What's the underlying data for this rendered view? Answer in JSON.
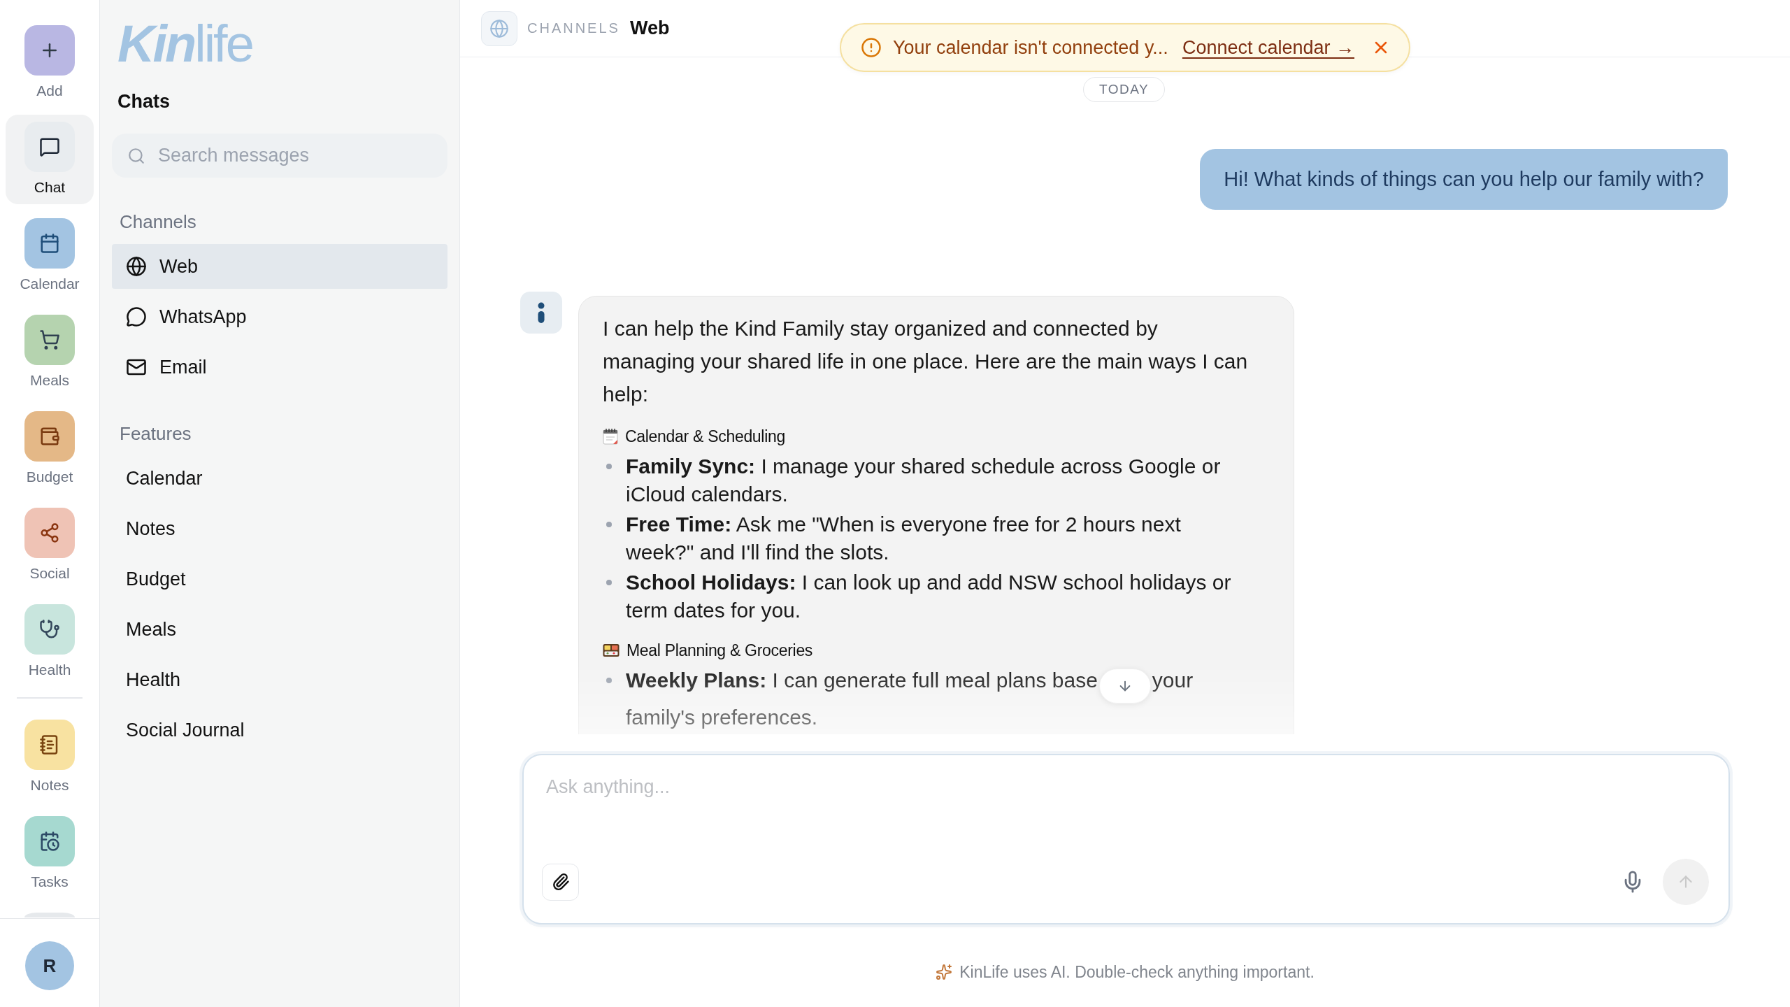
{
  "rail": {
    "sections": [
      {
        "items": [
          {
            "kind": "tile",
            "label": "Add",
            "selected": false,
            "color": "#b9b7e3"
          },
          {
            "kind": "tile",
            "label": "Chat",
            "selected": true,
            "color": "#e8ecef"
          },
          {
            "kind": "tile",
            "label": "Calendar",
            "selected": false,
            "color": "#a3c4e2"
          },
          {
            "kind": "tile",
            "label": "Meals",
            "selected": false,
            "color": "#b5d3af"
          },
          {
            "kind": "tile",
            "label": "Budget",
            "selected": false,
            "color": "#e4b887"
          },
          {
            "kind": "tile",
            "label": "Social",
            "selected": false,
            "color": "#efc3b5"
          },
          {
            "kind": "tile",
            "label": "Health",
            "selected": false,
            "color": "#c8e5dd"
          }
        ]
      },
      {
        "items": [
          {
            "kind": "tile",
            "label": "Notes",
            "selected": false,
            "color": "#f8e2a1"
          },
          {
            "kind": "tile",
            "label": "Tasks",
            "selected": false,
            "color": "#a6d9d0"
          },
          {
            "kind": "clipped",
            "selected": false,
            "color": "#e6e9ec"
          }
        ]
      }
    ],
    "avatar": "R"
  },
  "sidebar": {
    "logo": "**Kin**life",
    "title": "Chats",
    "search": {
      "placeholder": "Search messages"
    },
    "groups": [
      {
        "kind": "iconic",
        "heading": "Channels",
        "items": [
          {
            "label": "Web",
            "selected": true
          },
          {
            "label": "WhatsApp",
            "selected": false
          },
          {
            "label": "Email",
            "selected": false
          }
        ]
      },
      {
        "kind": "plain",
        "heading": "Features",
        "items": [
          {
            "label": "Calendar",
            "selected": false
          },
          {
            "label": "Notes",
            "selected": false
          },
          {
            "label": "Budget",
            "selected": false
          },
          {
            "label": "Meals",
            "selected": false
          },
          {
            "label": "Health",
            "selected": false
          },
          {
            "label": "Social Journal",
            "selected": false
          }
        ]
      }
    ]
  },
  "header": {
    "section": "CHANNELS",
    "title": "Web"
  },
  "banner": {
    "message": "Your calendar isn't connected y...",
    "link": "Connect calendar →"
  },
  "chat": {
    "date": "TODAY",
    "messages": [
      {
        "kind": "user",
        "text": "Hi! What kinds of things can you help our family with?"
      },
      {
        "kind": "assistant",
        "intro": "I can help the Kind Family stay organized and connected by managing your shared life in one place. Here are the main ways I can help:",
        "sections": [
          {
            "heading": "Calendar & Scheduling",
            "bullets": [
              {
                "text": "**Family Sync:** I manage your shared schedule across Google or iCloud calendars."
              },
              {
                "text": "**Free Time:** Ask me \"When is everyone free for 2 hours next week?\" and I'll find the slots."
              },
              {
                "text": "**School Holidays:** I can look up and add NSW school holidays or term dates for you."
              }
            ]
          },
          {
            "heading": "Meal Planning & Groceries",
            "bullets": [
              {
                "text": "**Weekly Plans:** I can generate full meal plans base",
                "text_after": "your",
                "continuation": "family's preferences."
              }
            ]
          }
        ]
      }
    ]
  },
  "composer": {
    "placeholder": "Ask anything...",
    "send": {
      "disabled": true
    }
  },
  "footer": {
    "text": "KinLife uses AI. Double-check anything important."
  }
}
